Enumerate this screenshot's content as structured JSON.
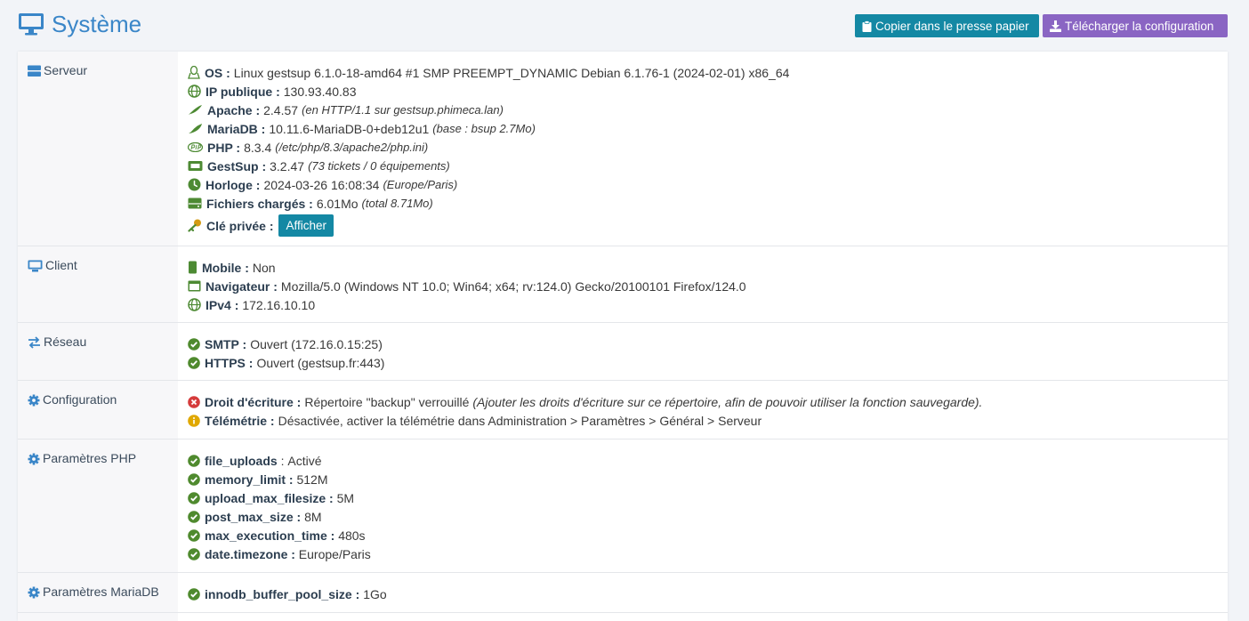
{
  "header": {
    "title": "Système",
    "copy_label": "Copier dans le presse papier",
    "download_label": "Télécharger la configuration"
  },
  "sections": {
    "server": {
      "title": "Serveur",
      "os_label": "OS :",
      "os_value": "Linux gestsup 6.1.0-18-amd64 #1 SMP PREEMPT_DYNAMIC Debian 6.1.76-1 (2024-02-01) x86_64",
      "ip_label": "IP publique :",
      "ip_value": "130.93.40.83",
      "apache_label": "Apache :",
      "apache_value": "2.4.57",
      "apache_note": "(en HTTP/1.1 sur gestsup.phimeca.lan)",
      "mariadb_label": "MariaDB :",
      "mariadb_value": "10.11.6-MariaDB-0+deb12u1",
      "mariadb_note": "(base : bsup 2.7Mo)",
      "php_label": "PHP :",
      "php_value": "8.3.4",
      "php_note": "(/etc/php/8.3/apache2/php.ini)",
      "gestsup_label": "GestSup :",
      "gestsup_value": "3.2.47",
      "gestsup_note": "(73 tickets / 0 équipements)",
      "clock_label": "Horloge :",
      "clock_value": "2024-03-26 16:08:34",
      "clock_note": "(Europe/Paris)",
      "files_label": "Fichiers chargés :",
      "files_value": "6.01Mo",
      "files_note": "(total 8.71Mo)",
      "key_label": "Clé privée :",
      "key_button": "Afficher"
    },
    "client": {
      "title": "Client",
      "mobile_label": "Mobile :",
      "mobile_value": "Non",
      "browser_label": "Navigateur :",
      "browser_value": "Mozilla/5.0 (Windows NT 10.0; Win64; x64; rv:124.0) Gecko/20100101 Firefox/124.0",
      "ipv4_label": "IPv4 :",
      "ipv4_value": "172.16.10.10"
    },
    "network": {
      "title": "Réseau",
      "smtp_label": "SMTP :",
      "smtp_value": "Ouvert (172.16.0.15:25)",
      "https_label": "HTTPS :",
      "https_value": "Ouvert (gestsup.fr:443)"
    },
    "config": {
      "title": "Configuration",
      "write_label": "Droit d'écriture :",
      "write_value": "Répertoire \"backup\" verrouillé",
      "write_note": "(Ajouter les droits d'écriture sur ce répertoire, afin de pouvoir utiliser la fonction sauvegarde).",
      "telemetry_label": "Télémétrie :",
      "telemetry_value": "Désactivée, activer la télémétrie dans Administration > Paramètres > Général > Serveur"
    },
    "php_params": {
      "title": "Paramètres PHP",
      "items": [
        {
          "label": "file_uploads",
          "sep": " : ",
          "value": "Activé"
        },
        {
          "label": "memory_limit :",
          "sep": " ",
          "value": "512M"
        },
        {
          "label": "upload_max_filesize :",
          "sep": " ",
          "value": "5M"
        },
        {
          "label": "post_max_size :",
          "sep": " ",
          "value": "8M"
        },
        {
          "label": "max_execution_time :",
          "sep": " ",
          "value": "480s"
        },
        {
          "label": "date.timezone :",
          "sep": " ",
          "value": "Europe/Paris"
        }
      ]
    },
    "mariadb_params": {
      "title": "Paramètres MariaDB",
      "pool_label": "innodb_buffer_pool_size :",
      "pool_value": "1Go"
    }
  },
  "colors": {
    "accent": "#3a86c8",
    "teal": "#1488a4",
    "purple": "#8a65c3",
    "icon_green": "#4d8a33",
    "ok_green": "#4f8a2e",
    "error_red": "#d53b3b",
    "warn_yellow": "#e0a800"
  }
}
